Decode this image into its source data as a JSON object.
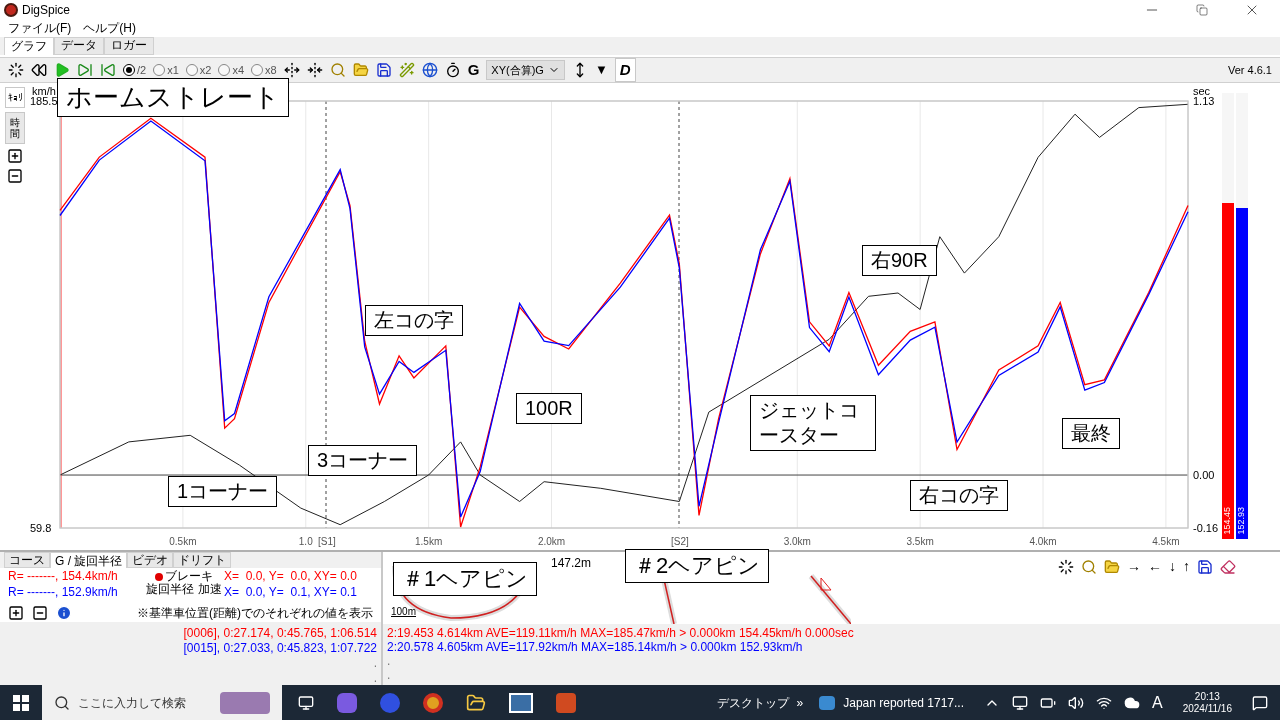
{
  "window": {
    "title": "DigSpice"
  },
  "menu": [
    "ファイル(F)",
    "ヘルプ(H)"
  ],
  "tabs": [
    {
      "label": "グラフ",
      "selected": true
    },
    {
      "label": "データ",
      "selected": false
    },
    {
      "label": "ロガー",
      "selected": false
    }
  ],
  "toolbar": {
    "rates": [
      {
        "label": "/2",
        "selected": true
      },
      {
        "label": "x1",
        "selected": false
      },
      {
        "label": "x2",
        "selected": false
      },
      {
        "label": "x4",
        "selected": false
      },
      {
        "label": "x8",
        "selected": false
      }
    ],
    "g_label": "G",
    "mode_select": "XY(合算)G",
    "marker": "▼",
    "d_label": "D",
    "version": "Ver 4.6.1"
  },
  "chart": {
    "axis_tabs": [
      {
        "label": "ｷｮﾘ",
        "selected": true
      },
      {
        "label": "時間",
        "selected": false
      }
    ],
    "sectors": [
      "[S1]",
      "[S2]"
    ],
    "speed_chart": {
      "chart_data": {
        "type": "line",
        "ylabel": "km/h",
        "xlim": [
          0,
          4.59
        ],
        "ylim": [
          59.8,
          185.5
        ],
        "x": [
          0,
          0.16,
          0.37,
          0.59,
          0.67,
          0.71,
          0.85,
          1.14,
          1.18,
          1.24,
          1.3,
          1.38,
          1.44,
          1.57,
          1.63,
          1.71,
          1.87,
          1.97,
          2.07,
          2.28,
          2.48,
          2.52,
          2.6,
          2.68,
          2.85,
          2.97,
          3.05,
          3.13,
          3.21,
          3.33,
          3.46,
          3.56,
          3.65,
          3.82,
          3.98,
          4.07,
          4.17,
          4.25,
          4.43,
          4.59
        ],
        "xticks": [
          {
            "value": 0.5,
            "label": "0.5km"
          },
          {
            "value": 1.0,
            "label": "1.0"
          },
          {
            "value": 1.5,
            "label": "1.5km"
          },
          {
            "value": 2.0,
            "label": "2.0km"
          },
          {
            "value": 3.0,
            "label": "3.0km"
          },
          {
            "value": 3.5,
            "label": "3.5km"
          },
          {
            "value": 4.0,
            "label": "4.0km"
          },
          {
            "value": 4.5,
            "label": "4.5km"
          }
        ],
        "yticks": [
          {
            "value": 59.8,
            "label": "59.8"
          },
          {
            "value": 185.5,
            "label": "185.5"
          }
        ],
        "series": [
          {
            "color": "#ff0000",
            "values": [
              153.3,
              169.0,
              180.4,
              169.0,
              89.2,
              92.0,
              126.2,
              164.7,
              154.7,
              114.8,
              96.3,
              110.5,
              104.0,
              113.4,
              60.1,
              77.8,
              124.8,
              116.2,
              112.5,
              131.9,
              151.9,
              137.6,
              63.5,
              92.0,
              140.5,
              162.7,
              120.5,
              113.4,
              129.1,
              107.7,
              117.7,
              120.5,
              82.9,
              106.3,
              113.4,
              126.2,
              102.0,
              103.4,
              129.1,
              154.7
            ]
          },
          {
            "color": "#0000ff",
            "values": [
              151.8,
              168.1,
              179.6,
              167.9,
              91.4,
              93.5,
              127.9,
              165.3,
              153.8,
              113.1,
              99.2,
              108.8,
              105.6,
              112.1,
              63.0,
              76.4,
              125.9,
              114.8,
              113.5,
              130.7,
              151.0,
              136.4,
              66.2,
              90.8,
              141.7,
              161.9,
              118.8,
              111.7,
              127.8,
              104.9,
              115.1,
              118.9,
              85.1,
              104.7,
              111.6,
              124.9,
              100.4,
              102.6,
              128.5,
              152.9
            ]
          }
        ]
      }
    },
    "time_chart": {
      "chart_data": {
        "type": "line",
        "ylabel": "sec",
        "xlim": [
          0,
          4.59
        ],
        "ylim": [
          -0.16,
          1.13
        ],
        "x": [
          0,
          0.28,
          0.53,
          0.73,
          0.98,
          1.14,
          1.32,
          1.5,
          1.63,
          1.71,
          1.87,
          1.97,
          2.2,
          2.36,
          2.52,
          2.64,
          3.13,
          3.29,
          3.41,
          3.5,
          3.58,
          3.68,
          3.82,
          3.98,
          4.13,
          4.23,
          4.39,
          4.59
        ],
        "yticks": [
          {
            "value": -0.16,
            "label": "-0.16"
          },
          {
            "value": 0,
            "label": "0.00"
          },
          {
            "value": 1.13,
            "label": "1.13"
          }
        ],
        "series": [
          {
            "color": "#222222",
            "values": [
              0,
              0.1,
              0.12,
              0.03,
              -0.1,
              -0.15,
              -0.08,
              0,
              0.1,
              0,
              -0.08,
              -0.02,
              -0.04,
              -0.06,
              -0.08,
              0.19,
              0.41,
              0.54,
              0.55,
              0.5,
              0.72,
              0.61,
              0.72,
              0.96,
              1.09,
              1.02,
              1.11,
              1.12
            ]
          }
        ]
      }
    },
    "bars": [
      {
        "reading": "154.45",
        "level": 0.753,
        "color": "#ff0000"
      },
      {
        "reading": "152.93",
        "level": 0.741,
        "color": "#0000ff"
      }
    ]
  },
  "callouts": [
    "ホームストレート",
    "左コの字",
    "100R",
    "3コーナー",
    "1コーナー",
    "ジェットコースター",
    "右90R",
    "最終",
    "右コの字",
    "＃1ヘアピン",
    "＃2ヘアピン"
  ],
  "bottom_left": {
    "tabs": [
      {
        "label": "コース",
        "selected": false
      },
      {
        "label": "G / 旋回半径",
        "selected": true
      },
      {
        "label": "ビデオ",
        "selected": false
      },
      {
        "label": "ドリフト",
        "selected": false
      }
    ],
    "rows": [
      {
        "color": "#ff0000",
        "speed": "R= -------, 154.4km/h",
        "g": "X=  0.0, Y=  0.0, XY= 0.0"
      },
      {
        "color": "#0000ff",
        "speed": "R= -------, 152.9km/h",
        "g": "X=  0.0, Y=  0.1, XY= 0.1"
      }
    ],
    "gmeter_labels": [
      "ブレーキ",
      "旋回半径",
      "加速"
    ],
    "note": "※基準車位置(距離)でのそれぞれの値を表示",
    "laps": [
      {
        "color": "#ff0000",
        "text": "[0006], 0:27.174, 0:45.765, 1:06.514"
      },
      {
        "color": "#0000ff",
        "text": "[0015], 0:27.033, 0:45.823, 1:07.722"
      }
    ],
    "dots": [
      ".",
      "."
    ]
  },
  "map": {
    "distance": "147.2m",
    "scale": "100m",
    "arrows": [
      "→",
      "←",
      "↓",
      "↑"
    ],
    "laps": [
      {
        "color": "#ff0000",
        "text": "2:19.453 4.614km AVE=119.11km/h MAX=185.47km/h > 0.000km 154.45km/h 0.000sec"
      },
      {
        "color": "#0000ff",
        "text": "2:20.578 4.605km AVE=117.92km/h MAX=185.14km/h > 0.000km 152.93km/h"
      }
    ],
    "dots": [
      ".",
      "."
    ]
  },
  "taskbar": {
    "search_placeholder": "ここに入力して検索",
    "desktop": "デスクトップ",
    "overflow": "»",
    "news": "Japan reported 1717...",
    "ime": "A",
    "time": "20:13",
    "date": "2024/11/16"
  }
}
